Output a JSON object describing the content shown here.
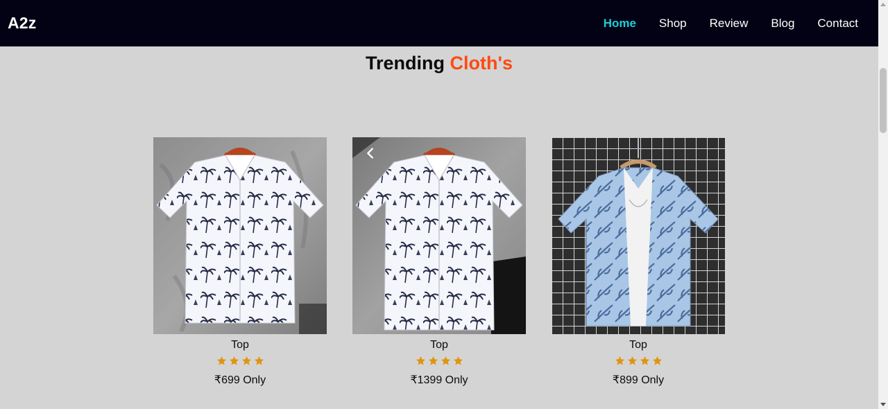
{
  "brand": {
    "logo": "A2z"
  },
  "nav": {
    "links": [
      {
        "label": "Home",
        "active": true
      },
      {
        "label": "Shop",
        "active": false
      },
      {
        "label": "Review",
        "active": false
      },
      {
        "label": "Blog",
        "active": false
      },
      {
        "label": "Contact",
        "active": false
      }
    ]
  },
  "section": {
    "title_main": "Trending",
    "title_accent": "Cloth's"
  },
  "products": [
    {
      "name": "Top",
      "rating": 4,
      "price": "₹699 Only",
      "image": "white-palm-print-shirt"
    },
    {
      "name": "Top",
      "rating": 4,
      "price": "₹1399 Only",
      "image": "white-palm-print-shirt-with-shorts"
    },
    {
      "name": "Top",
      "rating": 4,
      "price": "₹899 Only",
      "image": "blue-leaf-print-shirt"
    }
  ],
  "colors": {
    "navbar_bg": "#020214",
    "nav_active": "#1ecfd6",
    "accent": "#ff4a12",
    "star": "#e1940e",
    "page_bg": "#d4d4d4"
  }
}
